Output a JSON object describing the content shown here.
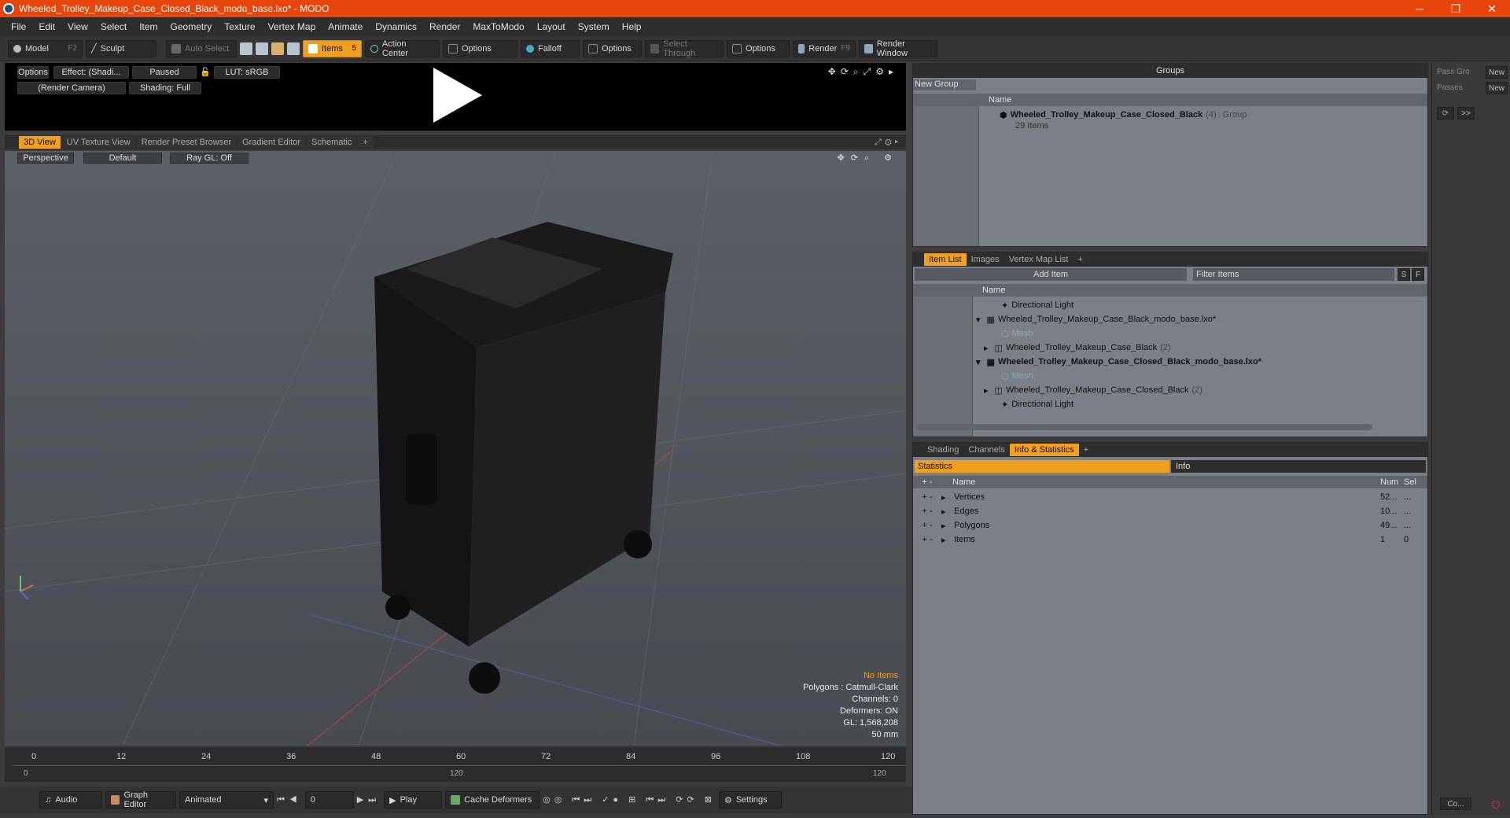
{
  "window": {
    "title": "Wheeled_Trolley_Makeup_Case_Closed_Black_modo_base.lxo* - MODO",
    "minimize": "─",
    "maximize": "❐",
    "close": "✕"
  },
  "menu": [
    "File",
    "Edit",
    "View",
    "Select",
    "Item",
    "Geometry",
    "Texture",
    "Vertex Map",
    "Animate",
    "Dynamics",
    "Render",
    "MaxToModo",
    "Layout",
    "System",
    "Help"
  ],
  "toolbar": {
    "model": "Model",
    "model_key": "F2",
    "sculpt": "Sculpt",
    "auto_select": "Auto Select",
    "items": "Items",
    "items_key": "5",
    "action_center": "Action Center",
    "options1": "Options",
    "falloff": "Falloff",
    "options2": "Options",
    "select_through": "Select Through",
    "options3": "Options",
    "render": "Render",
    "render_key": "F9",
    "render_window": "Render Window"
  },
  "preview": {
    "options": "Options",
    "effect": "Effect: (Shadi...",
    "paused": "Paused",
    "lut": "LUT: sRGB",
    "camera": "(Render Camera)",
    "shading": "Shading: Full"
  },
  "viewport_tabs": [
    "3D View",
    "UV Texture View",
    "Render Preset Browser",
    "Gradient Editor",
    "Schematic",
    "+"
  ],
  "viewport": {
    "perspective": "Perspective",
    "default": "Default",
    "raygl": "Ray GL: Off",
    "stats": {
      "no_items": "No Items",
      "polygons": "Polygons : Catmull-Clark",
      "channels": "Channels: 0",
      "deformers": "Deformers: ON",
      "gl": "GL: 1,568,208",
      "lens": "50 mm"
    }
  },
  "timeline": {
    "ticks": [
      "0",
      "12",
      "24",
      "36",
      "48",
      "60",
      "72",
      "84",
      "96",
      "108",
      "120"
    ],
    "sub_start": "0",
    "sub_mid": "120",
    "sub_end": "120"
  },
  "bottom": {
    "audio": "Audio",
    "graph_editor": "Graph Editor",
    "animated": "Animated",
    "frame": "0",
    "play": "Play",
    "cache": "Cache Deformers",
    "settings": "Settings"
  },
  "groups": {
    "header": "Groups",
    "new_group": "New Group",
    "col_name": "Name",
    "group_name": "Wheeled_Trolley_Makeup_Case_Closed_Black",
    "group_count": "(4)",
    "group_type": ": Group",
    "group_items": "29 Items"
  },
  "passes": {
    "pass_group": "Pass Gro",
    "new1": "New",
    "passes": "Passes",
    "new2": "New",
    "more": ">>",
    "co": "Co..."
  },
  "itemlist": {
    "tabs": [
      "Item List",
      "Images",
      "Vertex Map List",
      "+"
    ],
    "add_item": "Add Item",
    "filter": "Filter Items",
    "s": "S",
    "f": "F",
    "col_name": "Name",
    "rows": [
      {
        "label": "Directional Light",
        "extra": "",
        "dim": false,
        "bold": false
      },
      {
        "label": "Wheeled_Trolley_Makeup_Case_Black_modo_base.lxo*",
        "extra": "",
        "dim": false,
        "bold": false
      },
      {
        "label": "Mesh",
        "extra": "",
        "dim": true,
        "bold": false
      },
      {
        "label": "Wheeled_Trolley_Makeup_Case_Black",
        "extra": "(2)",
        "dim": false,
        "bold": false
      },
      {
        "label": "Wheeled_Trolley_Makeup_Case_Closed_Black_modo_base.lxo*",
        "extra": "",
        "dim": false,
        "bold": true
      },
      {
        "label": "Mesh",
        "extra": "",
        "dim": true,
        "bold": false
      },
      {
        "label": "Wheeled_Trolley_Makeup_Case_Closed_Black",
        "extra": "(2)",
        "dim": false,
        "bold": false
      },
      {
        "label": "Directional Light",
        "extra": "",
        "dim": false,
        "bold": false
      }
    ]
  },
  "info": {
    "tabs": [
      "Shading",
      "Channels",
      "Info & Statistics",
      "+"
    ],
    "statistics": "Statistics",
    "info": "Info",
    "col_name": "Name",
    "col_num": "Num",
    "col_sel": "Sel",
    "rows": [
      {
        "name": "Vertices",
        "num": "52...",
        "sel": "..."
      },
      {
        "name": "Edges",
        "num": "10...",
        "sel": "..."
      },
      {
        "name": "Polygons",
        "num": "49...",
        "sel": "..."
      },
      {
        "name": "Items",
        "num": "1",
        "sel": "0"
      }
    ]
  },
  "colors": {
    "accent": "#f0a020",
    "titlebar": "#e8450d"
  }
}
